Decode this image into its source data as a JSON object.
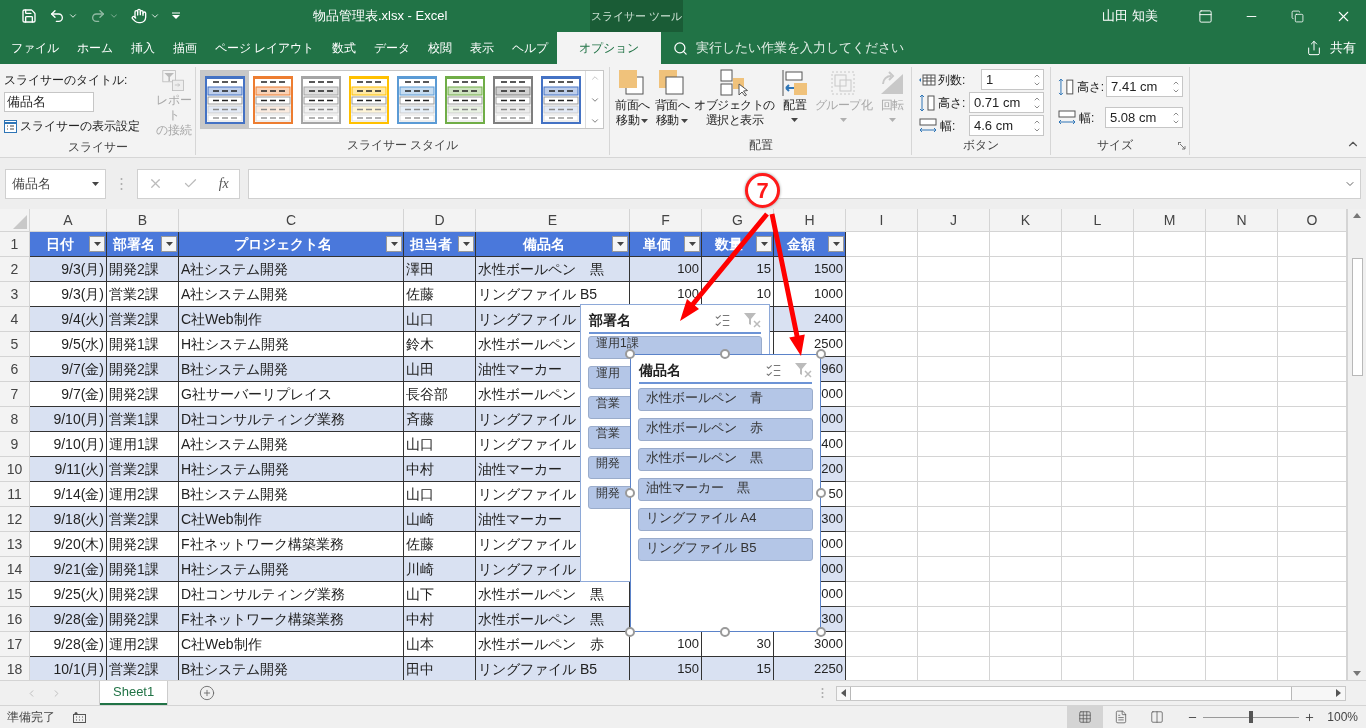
{
  "window": {
    "title": "物品管理表.xlsx - Excel",
    "context_tab": "スライサー ツール",
    "user": "山田 知美"
  },
  "ribbon_tabs": [
    {
      "label": "ファイル",
      "selected": false
    },
    {
      "label": "ホーム",
      "selected": false
    },
    {
      "label": "挿入",
      "selected": false
    },
    {
      "label": "描画",
      "selected": false
    },
    {
      "label": "ページ レイアウト",
      "selected": false
    },
    {
      "label": "数式",
      "selected": false
    },
    {
      "label": "データ",
      "selected": false
    },
    {
      "label": "校閲",
      "selected": false
    },
    {
      "label": "表示",
      "selected": false
    },
    {
      "label": "ヘルプ",
      "selected": false
    },
    {
      "label": "オプション",
      "selected": true
    }
  ],
  "tell_me": {
    "placeholder": "実行したい作業を入力してください"
  },
  "share": "共有",
  "ribbon": {
    "slicer_group": {
      "title_label": "スライサーのタイトル:",
      "title_value": "備品名",
      "settings": "スライサーの表示設定",
      "report_connections": {
        "lines": [
          "レポート",
          "の接続"
        ],
        "disabled": true
      },
      "group_label": "スライサー"
    },
    "styles": {
      "group_label": "スライサー スタイル",
      "items": [
        {
          "color": "#4472c4",
          "selected": true
        },
        {
          "color": "#ed7d31",
          "selected": false
        },
        {
          "color": "#a5a5a5",
          "selected": false
        },
        {
          "color": "#ffc000",
          "selected": false
        },
        {
          "color": "#5b9bd5",
          "selected": false
        },
        {
          "color": "#70ad47",
          "selected": false
        },
        {
          "color": "#7f7f7f",
          "selected": false
        },
        {
          "color": "#4472c4",
          "selected": false
        }
      ]
    },
    "arrange": {
      "group_label": "配置",
      "buttons": [
        {
          "kind": "bring_forward",
          "lines": [
            "前面へ",
            "移動"
          ],
          "dropdown": true,
          "disabled": false
        },
        {
          "kind": "send_backward",
          "lines": [
            "背面へ",
            "移動"
          ],
          "dropdown": true,
          "disabled": false
        },
        {
          "kind": "selection_pane",
          "lines": [
            "オブジェクトの",
            "選択と表示"
          ],
          "dropdown": false,
          "disabled": false
        },
        {
          "kind": "align",
          "lines": [
            "配置"
          ],
          "dropdown": true,
          "disabled": false
        },
        {
          "kind": "group",
          "lines": [
            "グループ化"
          ],
          "dropdown": true,
          "disabled": true
        },
        {
          "kind": "rotate",
          "lines": [
            "回転"
          ],
          "dropdown": true,
          "disabled": true
        }
      ]
    },
    "button_group": {
      "group_label": "ボタン",
      "fields": [
        {
          "kind": "columns",
          "label": "列数:",
          "value": "1"
        },
        {
          "kind": "height",
          "label": "高さ:",
          "value": "0.71 cm"
        },
        {
          "kind": "width",
          "label": "幅:",
          "value": "4.6 cm"
        }
      ]
    },
    "size_group": {
      "group_label": "サイズ",
      "fields": [
        {
          "kind": "height",
          "label": "高さ:",
          "value": "7.41 cm"
        },
        {
          "kind": "width",
          "label": "幅:",
          "value": "5.08 cm"
        }
      ]
    }
  },
  "formula_bar": {
    "name_box": "備品名",
    "fx": "fx"
  },
  "sheet": {
    "columns": [
      "A",
      "B",
      "C",
      "D",
      "E",
      "F",
      "G",
      "H",
      "I",
      "J",
      "K",
      "L",
      "M",
      "N",
      "O"
    ],
    "header_row_number": "1",
    "headers": [
      "日付",
      "部署名",
      "プロジェクト名",
      "担当者",
      "備品名",
      "単価",
      "数量",
      "金額"
    ],
    "rows": [
      {
        "number": "2",
        "cells": [
          "9/3(月)",
          "開発2課",
          "A社システム開発",
          "澤田",
          "水性ボールペン　黒",
          "100",
          "15",
          "1500"
        ]
      },
      {
        "number": "3",
        "cells": [
          "9/3(月)",
          "営業2課",
          "A社システム開発",
          "佐藤",
          "リングファイル B5",
          "100",
          "10",
          "1000"
        ]
      },
      {
        "number": "4",
        "cells": [
          "9/4(火)",
          "営業2課",
          "C社Web制作",
          "山口",
          "リングファイル",
          null,
          null,
          "2400"
        ]
      },
      {
        "number": "5",
        "cells": [
          "9/5(水)",
          "開発1課",
          "H社システム開発",
          "鈴木",
          "水性ボールペン",
          null,
          null,
          "2500"
        ]
      },
      {
        "number": "6",
        "cells": [
          "9/7(金)",
          "開発2課",
          "B社システム開発",
          "山田",
          "油性マーカー",
          null,
          null,
          "960"
        ]
      },
      {
        "number": "7",
        "cells": [
          "9/7(金)",
          "開発2課",
          "G社サーバーリプレイス",
          "長谷部",
          "水性ボールペン",
          null,
          null,
          "000"
        ]
      },
      {
        "number": "8",
        "cells": [
          "9/10(月)",
          "営業1課",
          "D社コンサルティング業務",
          "斉藤",
          "リングファイル",
          null,
          null,
          "000"
        ]
      },
      {
        "number": "9",
        "cells": [
          "9/10(月)",
          "運用1課",
          "A社システム開発",
          "山口",
          "リングファイル",
          null,
          null,
          "400"
        ]
      },
      {
        "number": "10",
        "cells": [
          "9/11(火)",
          "営業2課",
          "H社システム開発",
          "中村",
          "油性マーカー",
          null,
          null,
          "200"
        ]
      },
      {
        "number": "11",
        "cells": [
          "9/14(金)",
          "運用2課",
          "B社システム開発",
          "山口",
          "リングファイル",
          null,
          null,
          "50"
        ]
      },
      {
        "number": "12",
        "cells": [
          "9/18(火)",
          "営業2課",
          "C社Web制作",
          "山崎",
          "油性マーカー",
          null,
          null,
          "300"
        ]
      },
      {
        "number": "13",
        "cells": [
          "9/20(木)",
          "開発2課",
          "F社ネットワーク構築業務",
          "佐藤",
          "リングファイル",
          null,
          null,
          "000"
        ]
      },
      {
        "number": "14",
        "cells": [
          "9/21(金)",
          "開発1課",
          "H社システム開発",
          "川崎",
          "リングファイル",
          null,
          null,
          "000"
        ]
      },
      {
        "number": "15",
        "cells": [
          "9/25(火)",
          "開発2課",
          "D社コンサルティング業務",
          "山下",
          "水性ボールペン　黒",
          null,
          null,
          "000"
        ]
      },
      {
        "number": "16",
        "cells": [
          "9/28(金)",
          "開発2課",
          "F社ネットワーク構築業務",
          "中村",
          "水性ボールペン　黒",
          null,
          null,
          "300"
        ]
      },
      {
        "number": "17",
        "cells": [
          "9/28(金)",
          "運用2課",
          "C社Web制作",
          "山本",
          "水性ボールペン　赤",
          "100",
          "30",
          "3000"
        ]
      },
      {
        "number": "18",
        "cells": [
          "10/1(月)",
          "営業2課",
          "B社システム開発",
          "田中",
          "リングファイル B5",
          "150",
          "15",
          "2250"
        ]
      }
    ]
  },
  "slicers": [
    {
      "title": "部署名",
      "selected": false,
      "items": [
        "運用1課",
        "運用",
        "営業",
        "営業",
        "開発",
        "開発"
      ]
    },
    {
      "title": "備品名",
      "selected": true,
      "items": [
        "水性ボールペン　青",
        "水性ボールペン　赤",
        "水性ボールペン　黒",
        "油性マーカー　黒",
        "リングファイル A4",
        "リングファイル B5"
      ]
    }
  ],
  "annotation": {
    "label": "7"
  },
  "sheets": [
    {
      "name": "Sheet1",
      "selected": true
    }
  ],
  "status_bar": {
    "text": "準備完了",
    "views": [
      {
        "kind": "normal",
        "selected": true
      },
      {
        "kind": "page_layout",
        "selected": false
      },
      {
        "kind": "page_break",
        "selected": false
      }
    ],
    "zoom": {
      "level": 0.5,
      "label": "100%"
    }
  }
}
